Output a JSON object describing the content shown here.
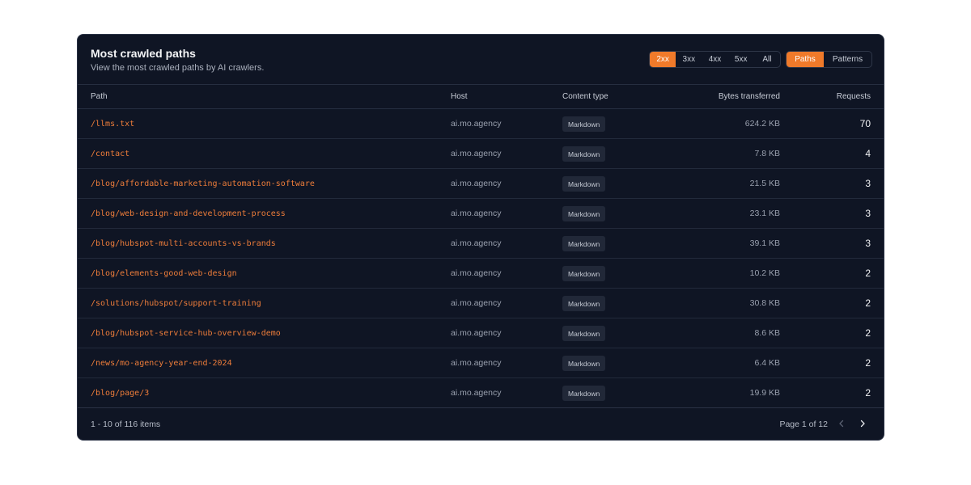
{
  "header": {
    "title": "Most crawled paths",
    "subtitle": "View the most crawled paths by AI crawlers."
  },
  "status_filters": [
    "2xx",
    "3xx",
    "4xx",
    "5xx",
    "All"
  ],
  "status_selected": "2xx",
  "view_toggle": [
    "Paths",
    "Patterns"
  ],
  "view_selected": "Paths",
  "table": {
    "columns": [
      "Path",
      "Host",
      "Content type",
      "Bytes transferred",
      "Requests"
    ],
    "rows": [
      {
        "path": "/llms.txt",
        "host": "ai.mo.agency",
        "type": "Markdown",
        "bytes": "624.2 KB",
        "requests": "70"
      },
      {
        "path": "/contact",
        "host": "ai.mo.agency",
        "type": "Markdown",
        "bytes": "7.8 KB",
        "requests": "4"
      },
      {
        "path": "/blog/affordable-marketing-automation-software",
        "host": "ai.mo.agency",
        "type": "Markdown",
        "bytes": "21.5 KB",
        "requests": "3"
      },
      {
        "path": "/blog/web-design-and-development-process",
        "host": "ai.mo.agency",
        "type": "Markdown",
        "bytes": "23.1 KB",
        "requests": "3"
      },
      {
        "path": "/blog/hubspot-multi-accounts-vs-brands",
        "host": "ai.mo.agency",
        "type": "Markdown",
        "bytes": "39.1 KB",
        "requests": "3"
      },
      {
        "path": "/blog/elements-good-web-design",
        "host": "ai.mo.agency",
        "type": "Markdown",
        "bytes": "10.2 KB",
        "requests": "2"
      },
      {
        "path": "/solutions/hubspot/support-training",
        "host": "ai.mo.agency",
        "type": "Markdown",
        "bytes": "30.8 KB",
        "requests": "2"
      },
      {
        "path": "/blog/hubspot-service-hub-overview-demo",
        "host": "ai.mo.agency",
        "type": "Markdown",
        "bytes": "8.6 KB",
        "requests": "2"
      },
      {
        "path": "/news/mo-agency-year-end-2024",
        "host": "ai.mo.agency",
        "type": "Markdown",
        "bytes": "6.4 KB",
        "requests": "2"
      },
      {
        "path": "/blog/page/3",
        "host": "ai.mo.agency",
        "type": "Markdown",
        "bytes": "19.9 KB",
        "requests": "2"
      }
    ]
  },
  "footer": {
    "count": "1 - 10 of 116 items",
    "page_info": "Page 1 of 12",
    "prev_icon": "chevron-left-icon",
    "next_icon": "chevron-right-icon"
  },
  "colors": {
    "accent": "#f07a2a",
    "background": "#0f1524",
    "path_text": "#ee7d3a"
  }
}
